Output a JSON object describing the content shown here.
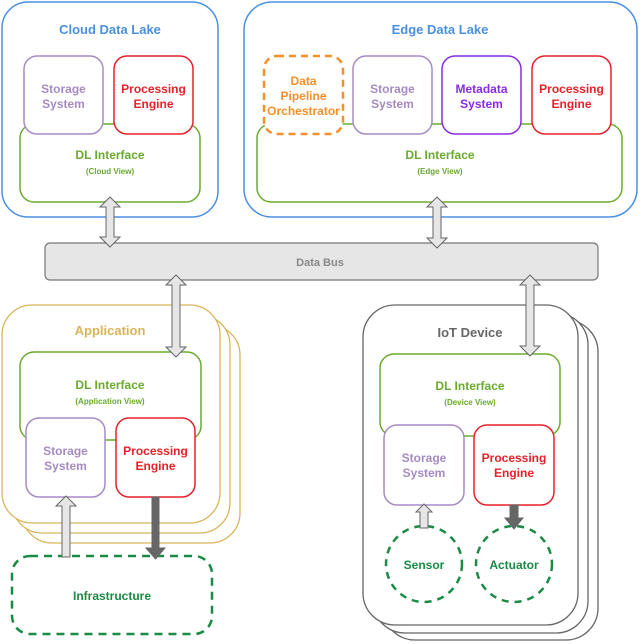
{
  "colors": {
    "data_lake": "#4A90E2",
    "interface": "#6AAB2E",
    "storage": "#A68BC3",
    "processing": "#E8202A",
    "metadata": "#8A2BE2",
    "orchestrator": "#F5902A",
    "application": "#D9B45A",
    "iot": "#666666",
    "external": "#1A8A45",
    "bus_fill": "#E6E6E6",
    "bus_stroke": "#777777",
    "bus_text": "#888888",
    "arrow_light": "#E6E6E6",
    "arrow_dark": "#666666"
  },
  "cloud": {
    "title": "Cloud Data Lake",
    "storage": [
      "Storage",
      "System"
    ],
    "processing": [
      "Processing",
      "Engine"
    ],
    "interface": {
      "title": "DL Interface",
      "view": "(Cloud View)"
    }
  },
  "edge": {
    "title": "Edge Data Lake",
    "orchestrator": [
      "Data",
      "Pipeline",
      "Orchestrator"
    ],
    "storage": [
      "Storage",
      "System"
    ],
    "metadata": [
      "Metadata",
      "System"
    ],
    "processing": [
      "Processing",
      "Engine"
    ],
    "interface": {
      "title": "DL Interface",
      "view": "(Edge View)"
    }
  },
  "bus": {
    "label": "Data Bus"
  },
  "application": {
    "title": "Application",
    "interface": {
      "title": "DL Interface",
      "view": "(Application View)"
    },
    "storage": [
      "Storage",
      "System"
    ],
    "processing": [
      "Processing",
      "Engine"
    ]
  },
  "infrastructure": {
    "label": "Infrastructure"
  },
  "iot": {
    "title": "IoT Device",
    "interface": {
      "title": "DL Interface",
      "view": "(Device View)"
    },
    "storage": [
      "Storage",
      "System"
    ],
    "processing": [
      "Processing",
      "Engine"
    ],
    "sensor": "Sensor",
    "actuator": "Actuator"
  }
}
